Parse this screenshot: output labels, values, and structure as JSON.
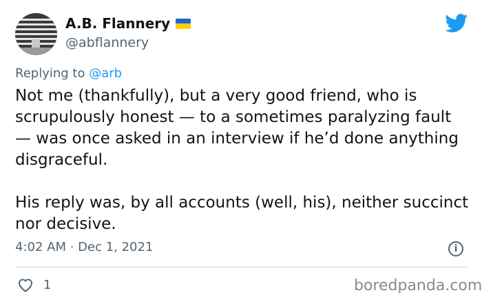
{
  "author": {
    "display_name": "A.B. Flannery",
    "handle": "@abflannery",
    "flag_colors": [
      "#1f63cf",
      "#ffd000"
    ]
  },
  "reply": {
    "prefix": "Replying to",
    "mention": "@arb"
  },
  "tweet": {
    "paragraphs": [
      "Not me (thankfully), but a very good friend, who is scrupulously honest — to a sometimes paralyzing fault — was once asked in an interview if he’d done anything disgraceful.",
      "His reply was, by all accounts (well, his), neither succinct nor decisive."
    ],
    "timestamp": "4:02 AM · Dec 1, 2021"
  },
  "actions": {
    "like_count": "1"
  },
  "watermark": "boredpanda.com",
  "icons": {
    "brand": "twitter-bird-icon",
    "info": "info-icon",
    "like": "heart-icon"
  },
  "colors": {
    "accent": "#1d9bf0",
    "secondary_text": "#536471",
    "primary_text": "#0f1419"
  }
}
